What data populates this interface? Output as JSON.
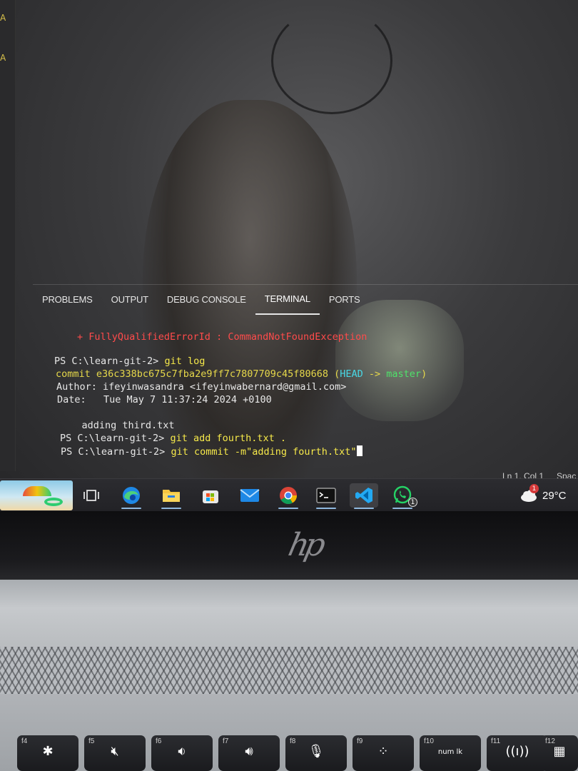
{
  "panel": {
    "tabs": [
      {
        "label": "PROBLEMS"
      },
      {
        "label": "OUTPUT"
      },
      {
        "label": "DEBUG CONSOLE"
      },
      {
        "label": "TERMINAL",
        "active": true
      },
      {
        "label": "PORTS"
      }
    ]
  },
  "terminal": {
    "error_line": "+ FullyQualifiedErrorId : CommandNotFoundException",
    "prompt": "PS C:\\learn-git-2>",
    "cmd_log": "git log",
    "commit_prefix": "commit e36c338bc675c7fba2e9ff7c7807709c45f80668 (",
    "head": "HEAD",
    "arrow": " -> ",
    "branch": "master",
    "commit_suffix": ")",
    "author_line": "Author: ifeyinwasandra <ifeyinwabernard@gmail.com>",
    "date_line": "Date:   Tue May 7 11:37:24 2024 +0100",
    "message_line": "    adding third.txt",
    "cmd_add": "git add fourth.txt .",
    "cmd_commit": "git commit -m\"adding fourth.txt\""
  },
  "statusbar": {
    "position": "Ln 1, Col 1",
    "spaces": "Spac"
  },
  "taskbar": {
    "icons": [
      "task-view-icon",
      "edge-icon",
      "file-explorer-icon",
      "microsoft-store-icon",
      "mail-icon",
      "chrome-icon",
      "terminal-icon",
      "vscode-icon",
      "whatsapp-icon"
    ],
    "whatsapp_badge": "1",
    "weather_badge": "1",
    "temperature": "29°C"
  },
  "colors": {
    "error": "#ff4b4b",
    "command": "#f6e94a",
    "head": "#48d8e6",
    "branch": "#4ee26a"
  },
  "keyboard": {
    "keys": [
      {
        "fn": "f4",
        "icon": "brightness-up-icon"
      },
      {
        "fn": "f5",
        "icon": "mute-icon"
      },
      {
        "fn": "f6",
        "icon": "volume-down-icon"
      },
      {
        "fn": "f7",
        "icon": "volume-up-icon"
      },
      {
        "fn": "f8",
        "icon": "mic-mute-icon"
      },
      {
        "fn": "f9",
        "icon": "keyboard-backlight-icon"
      },
      {
        "fn": "f10",
        "text": "num lk"
      },
      {
        "fn": "f11",
        "icon": "airplane-mode-icon"
      },
      {
        "fn": "f12",
        "icon": "calculator-icon"
      }
    ]
  }
}
